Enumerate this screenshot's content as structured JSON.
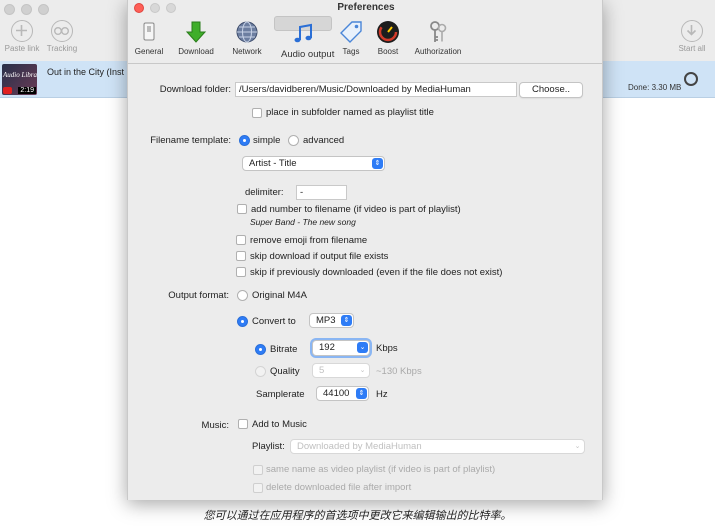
{
  "background": {
    "toolbar": {
      "paste_link": "Paste link",
      "tracking": "Tracking",
      "start_all": "Start all"
    },
    "row": {
      "thumbnail_text": "Audio Library",
      "duration": "2:19",
      "title": "Out in the City (Inst",
      "status": "Done: 3.30 MB"
    }
  },
  "window": {
    "title": "Preferences"
  },
  "toolbar": {
    "tabs": [
      {
        "label": "General",
        "icon": "switch-icon"
      },
      {
        "label": "Download",
        "icon": "download-arrow-icon"
      },
      {
        "label": "Network",
        "icon": "globe-icon"
      },
      {
        "label": "Audio output",
        "icon": "music-note-icon",
        "selected": true
      },
      {
        "label": "Tags",
        "icon": "tag-icon"
      },
      {
        "label": "Boost",
        "icon": "speedometer-icon"
      },
      {
        "label": "Authorization",
        "icon": "keys-icon"
      }
    ]
  },
  "download_folder": {
    "label": "Download folder:",
    "path": "/Users/davidberen/Music/Downloaded by MediaHuman",
    "choose": "Choose..",
    "subfolder_label": "place in subfolder named as playlist title"
  },
  "filename_template": {
    "label": "Filename template:",
    "simple": "simple",
    "advanced": "advanced",
    "selected": "simple",
    "template_value": "Artist - Title",
    "delimiter_label": "delimiter:",
    "delimiter_value": "-",
    "add_number_label": "add number to filename (if video is part of playlist)",
    "example": "Super Band - The new song"
  },
  "options": {
    "remove_emoji": "remove emoji from filename",
    "skip_existing": "skip download if output file exists",
    "skip_previous": "skip if previously downloaded (even if the file does not exist)"
  },
  "output_format": {
    "label": "Output format:",
    "original": "Original M4A",
    "convert_to": "Convert to",
    "format_value": "MP3",
    "bitrate_label": "Bitrate",
    "bitrate_value": "192",
    "bitrate_unit": "Kbps",
    "quality_label": "Quality",
    "quality_value": "5",
    "quality_unit": "~130 Kbps",
    "samplerate_label": "Samplerate",
    "samplerate_value": "44100",
    "samplerate_unit": "Hz"
  },
  "music": {
    "label": "Music:",
    "add_to_music": "Add to Music",
    "playlist_label": "Playlist:",
    "playlist_value": "Downloaded by MediaHuman",
    "same_name": "same name as video playlist (if video is part of playlist)",
    "delete_after": "delete downloaded file after import"
  },
  "caption": "您可以通过在应用程序的首选项中更改它来编辑输出的比特率。",
  "colors": {
    "accent": "#2e7cf6",
    "selected_row": "#cfe3f6",
    "close": "#fe5f57",
    "minimize": "#d8d8d8",
    "maximize": "#d8d8d8"
  }
}
